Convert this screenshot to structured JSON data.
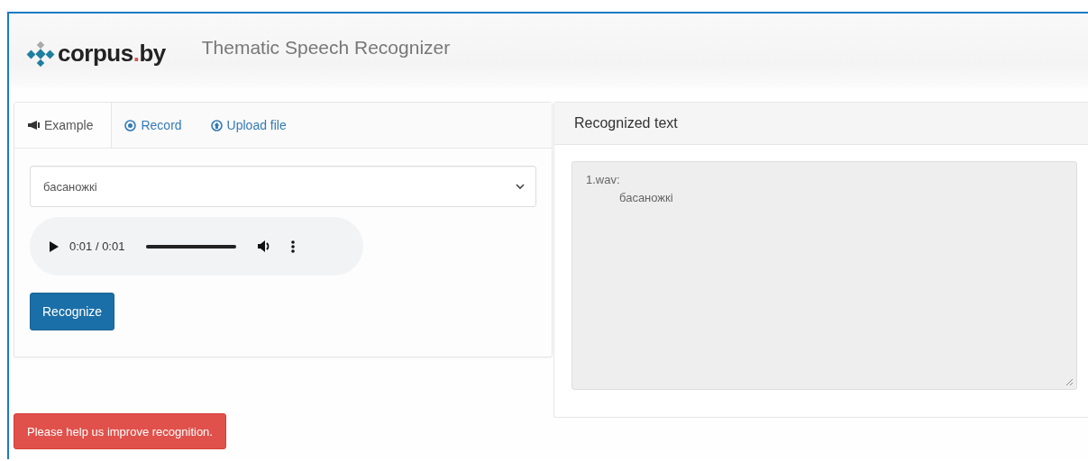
{
  "header": {
    "logo_text": "corpus",
    "logo_dot": ".",
    "logo_suffix": "by",
    "title": "Thematic Speech Recognizer"
  },
  "tabs": [
    {
      "label": "Example",
      "selected": true
    },
    {
      "label": "Record",
      "selected": false
    },
    {
      "label": "Upload file",
      "selected": false
    }
  ],
  "example_select": {
    "value": "басаножкі"
  },
  "audio_player": {
    "time": "0:01 / 0:01",
    "level": 1
  },
  "recognize_button": "Recognize",
  "result_panel": {
    "title": "Recognized text",
    "file": "1.wav:",
    "text": "басаножкі"
  },
  "help_button": "Please help us improve recognition."
}
